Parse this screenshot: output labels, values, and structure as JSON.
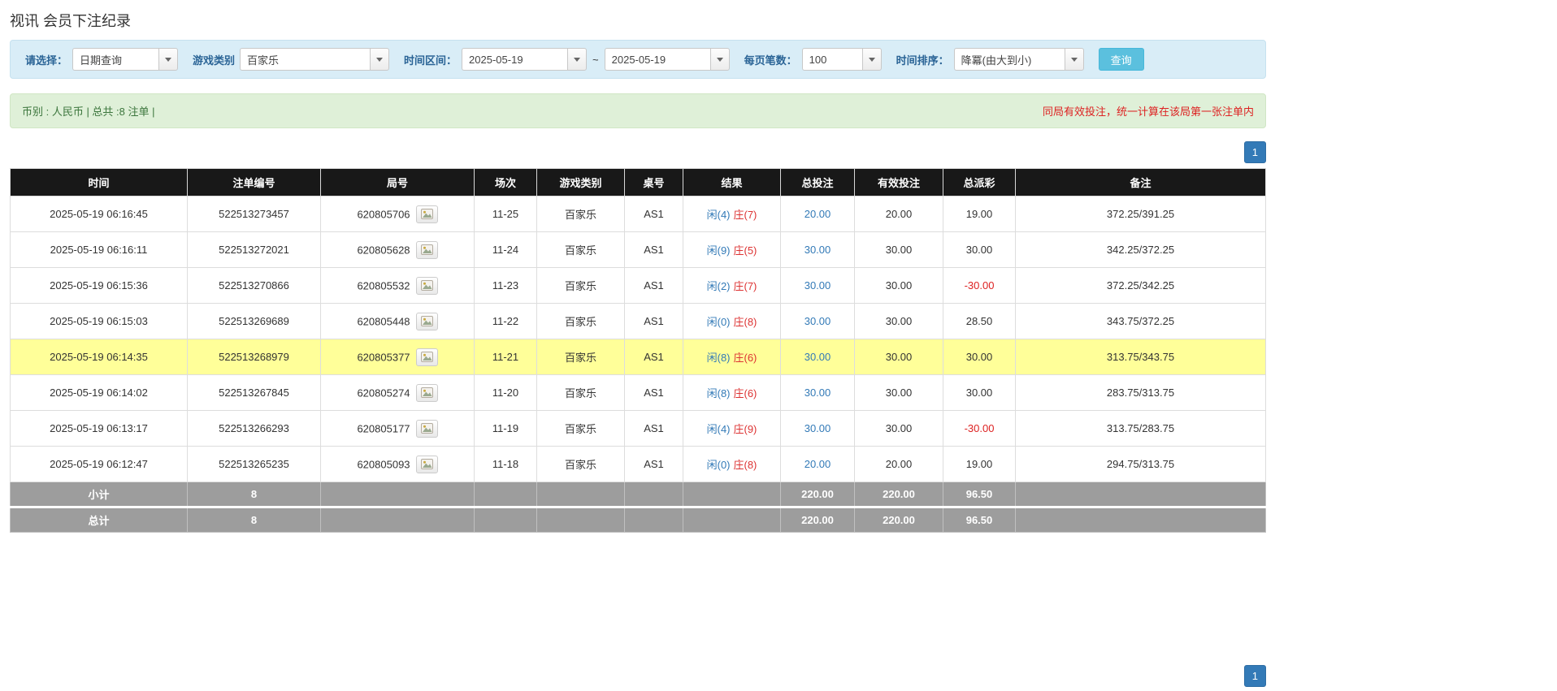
{
  "page": {
    "title": "视讯 会员下注纪录"
  },
  "filters": {
    "select_label": "请选择：",
    "select_value": "日期查询",
    "game_label": "游戏类别",
    "game_value": "百家乐",
    "range_label": "时间区间：",
    "date_from": "2025-05-19",
    "range_separator": "~",
    "date_to": "2025-05-19",
    "per_page_label": "每页笔数：",
    "per_page_value": "100",
    "sort_label": "时间排序：",
    "sort_value": "降冪(由大到小)",
    "search_button_label": "查询"
  },
  "summary": {
    "currency_info": "币别 : 人民币 | 总共 :8 注单 |",
    "notice": "同局有效投注，统一计算在该局第一张注单内"
  },
  "pagination": {
    "current_page": "1"
  },
  "table": {
    "headers": {
      "time": "时间",
      "bet_id": "注单编号",
      "round": "局号",
      "session": "场次",
      "game": "游戏类别",
      "table_no": "桌号",
      "result": "结果",
      "total_bet": "总投注",
      "valid_bet": "有效投注",
      "payout": "总派彩",
      "note": "备注"
    },
    "rows": [
      {
        "time": "2025-05-19 06:16:45",
        "bet_id": "522513273457",
        "round": "620805706",
        "session": "11-25",
        "game": "百家乐",
        "table_no": "AS1",
        "result_player": "闲(4)",
        "result_banker": "庄(7)",
        "total_bet": "20.00",
        "valid_bet": "20.00",
        "payout": "19.00",
        "note": "372.25/391.25",
        "highlight": false
      },
      {
        "time": "2025-05-19 06:16:11",
        "bet_id": "522513272021",
        "round": "620805628",
        "session": "11-24",
        "game": "百家乐",
        "table_no": "AS1",
        "result_player": "闲(9)",
        "result_banker": "庄(5)",
        "total_bet": "30.00",
        "valid_bet": "30.00",
        "payout": "30.00",
        "note": "342.25/372.25",
        "highlight": false
      },
      {
        "time": "2025-05-19 06:15:36",
        "bet_id": "522513270866",
        "round": "620805532",
        "session": "11-23",
        "game": "百家乐",
        "table_no": "AS1",
        "result_player": "闲(2)",
        "result_banker": "庄(7)",
        "total_bet": "30.00",
        "valid_bet": "30.00",
        "payout": "-30.00",
        "note": "372.25/342.25",
        "highlight": false
      },
      {
        "time": "2025-05-19 06:15:03",
        "bet_id": "522513269689",
        "round": "620805448",
        "session": "11-22",
        "game": "百家乐",
        "table_no": "AS1",
        "result_player": "闲(0)",
        "result_banker": "庄(8)",
        "total_bet": "30.00",
        "valid_bet": "30.00",
        "payout": "28.50",
        "note": "343.75/372.25",
        "highlight": false
      },
      {
        "time": "2025-05-19 06:14:35",
        "bet_id": "522513268979",
        "round": "620805377",
        "session": "11-21",
        "game": "百家乐",
        "table_no": "AS1",
        "result_player": "闲(8)",
        "result_banker": "庄(6)",
        "total_bet": "30.00",
        "valid_bet": "30.00",
        "payout": "30.00",
        "note": "313.75/343.75",
        "highlight": true
      },
      {
        "time": "2025-05-19 06:14:02",
        "bet_id": "522513267845",
        "round": "620805274",
        "session": "11-20",
        "game": "百家乐",
        "table_no": "AS1",
        "result_player": "闲(8)",
        "result_banker": "庄(6)",
        "total_bet": "30.00",
        "valid_bet": "30.00",
        "payout": "30.00",
        "note": "283.75/313.75",
        "highlight": false
      },
      {
        "time": "2025-05-19 06:13:17",
        "bet_id": "522513266293",
        "round": "620805177",
        "session": "11-19",
        "game": "百家乐",
        "table_no": "AS1",
        "result_player": "闲(4)",
        "result_banker": "庄(9)",
        "total_bet": "30.00",
        "valid_bet": "30.00",
        "payout": "-30.00",
        "note": "313.75/283.75",
        "highlight": false
      },
      {
        "time": "2025-05-19 06:12:47",
        "bet_id": "522513265235",
        "round": "620805093",
        "session": "11-18",
        "game": "百家乐",
        "table_no": "AS1",
        "result_player": "闲(0)",
        "result_banker": "庄(8)",
        "total_bet": "20.00",
        "valid_bet": "20.00",
        "payout": "19.00",
        "note": "294.75/313.75",
        "highlight": false
      }
    ],
    "subtotal": {
      "label": "小计",
      "count": "8",
      "total_bet": "220.00",
      "valid_bet": "220.00",
      "payout": "96.50"
    },
    "grand_total": {
      "label": "总计",
      "count": "8",
      "total_bet": "220.00",
      "valid_bet": "220.00",
      "payout": "96.50"
    }
  },
  "colors": {
    "accent_blue": "#337ab7",
    "filter_bar_bg": "#d9edf7",
    "summary_bar_bg": "#dff0d8",
    "table_header_bg": "#181818",
    "highlight_row_bg": "#ffff99",
    "footer_row_bg": "#9d9d9d",
    "negative_red": "#dd2222",
    "banker_red": "#dd3333",
    "player_blue": "#337ab7",
    "search_button_bg": "#5bc0de",
    "notice_red": "#dd2222"
  }
}
